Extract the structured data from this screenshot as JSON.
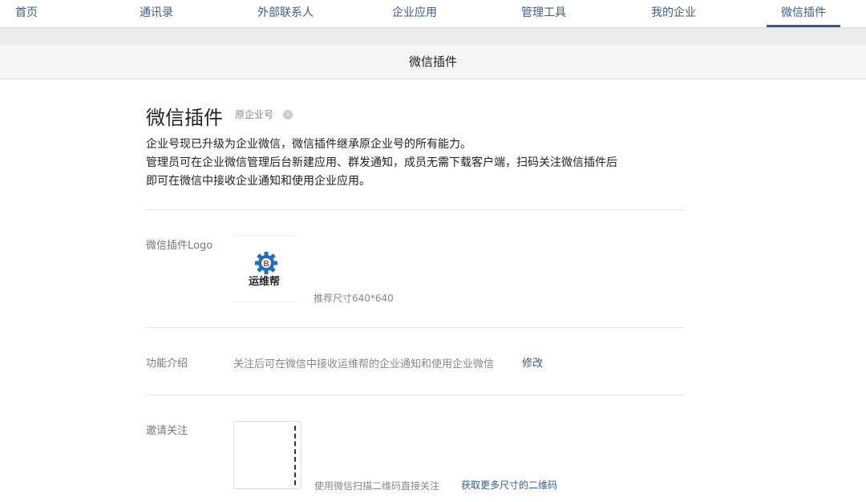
{
  "nav": {
    "items": [
      "首页",
      "通讯录",
      "外部联系人",
      "企业应用",
      "管理工具",
      "我的企业",
      "微信插件"
    ],
    "active": "微信插件"
  },
  "subheader": {
    "title": "微信插件"
  },
  "main": {
    "title": "微信插件",
    "subtitle": "原企业号",
    "info_icon": "i",
    "desc": [
      "企业号现已升级为企业微信，微信插件继承原企业号的所有能力。",
      "管理员可在企业微信管理后台新建应用、群发通知，成员无需下载客户端，扫码关注微信插件后",
      "即可在微信中接收企业通知和使用企业应用。"
    ],
    "logo": {
      "label": "微信插件Logo",
      "brand": "运维帮",
      "hint": "推荐尺寸640*640"
    },
    "intro": {
      "label": "功能介绍",
      "text": "关注后可在微信中接收运维帮的企业通知和使用企业微信",
      "edit": "修改"
    },
    "invite": {
      "label": "邀请关注",
      "hint": "使用微信扫描二维码直接关注",
      "more": "获取更多尺寸的二维码"
    }
  },
  "colors": {
    "accent": "#3f5a80",
    "link": "#2e5d92"
  }
}
